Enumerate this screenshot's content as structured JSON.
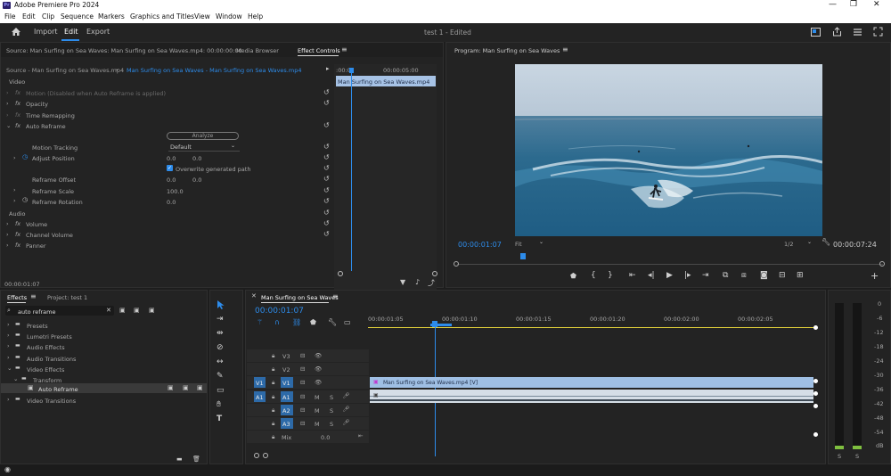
{
  "window": {
    "title": "Adobe Premiere Pro 2024",
    "logo_text": "Pr"
  },
  "menu": [
    "File",
    "Edit",
    "Clip",
    "Sequence",
    "Markers",
    "Graphics and Titles",
    "View",
    "Window",
    "Help"
  ],
  "workspaces": [
    "Import",
    "Edit",
    "Export"
  ],
  "document_title": "test 1  -  Edited",
  "effect_controls": {
    "tabs": [
      "Source: Man Surfing on Sea Waves: Man Surfing on Sea Waves.mp4: 00:00:00:00",
      "Media Browser",
      "Effect Controls"
    ],
    "source_label": "Source - Man Surfing on Sea Waves.mp4",
    "sequence_label": "Man Surfing on Sea Waves - Man Surfing on Sea Waves.mp4",
    "time_ticks": [
      ":00:0",
      "00:00:05:00"
    ],
    "clip_label": "Man Surfing on Sea Waves.mp4",
    "sections": {
      "video": "Video",
      "audio": "Audio"
    },
    "motion": "Motion  (Disabled when Auto Reframe is applied)",
    "opacity": "Opacity",
    "time_remapping": "Time Remapping",
    "auto_reframe": "Auto Reframe",
    "analyze": "Analyze",
    "motion_tracking": "Motion Tracking",
    "motion_tracking_value": "Default",
    "adjust_position": "Adjust Position",
    "adjust_x": "0.0",
    "adjust_y": "0.0",
    "overwrite": "Overwrite generated path",
    "reframe_offset": "Reframe Offset",
    "offset_x": "0.0",
    "offset_y": "0.0",
    "reframe_scale": "Reframe Scale",
    "scale_value": "100.0",
    "reframe_rotation": "Reframe Rotation",
    "rotation_value": "0.0",
    "volume": "Volume",
    "channel_volume": "Channel Volume",
    "panner": "Panner",
    "timecode": "00:00:01:07"
  },
  "program": {
    "title": "Program: Man Surfing on Sea Waves",
    "timecode": "00:00:01:07",
    "fit": "Fit",
    "resolution": "1/2",
    "duration": "00:00:07:24"
  },
  "effects": {
    "tabs": [
      "Effects",
      "Project: test 1"
    ],
    "search": "auto reframe",
    "tree": [
      "Presets",
      "Lumetri Presets",
      "Audio Effects",
      "Audio Transitions",
      "Video Effects",
      "Transform",
      "Auto Reframe",
      "Video Transitions"
    ]
  },
  "timeline": {
    "tab": "Man Surfing on Sea Waves",
    "timecode": "00:00:01:07",
    "ruler": [
      "00:00:01:05",
      "00:00:01:10",
      "00:00:01:15",
      "00:00:01:20",
      "00:00:02:00",
      "00:00:02:05"
    ],
    "video_tracks": [
      "V3",
      "V2",
      "V1"
    ],
    "audio_tracks": [
      "A1",
      "A2",
      "A3"
    ],
    "src_v": "V1",
    "src_a": "A1",
    "mix_label": "Mix",
    "mix_value": "0.0",
    "clip_label": "Man Surfing on Sea Waves.mp4 [V]",
    "mute": "M",
    "solo": "S"
  },
  "meter": {
    "scale": [
      "0",
      "-6",
      "-12",
      "-18",
      "-24",
      "-30",
      "-36",
      "-42",
      "-48",
      "-54",
      "dB"
    ],
    "solo": [
      "S",
      "S"
    ]
  }
}
